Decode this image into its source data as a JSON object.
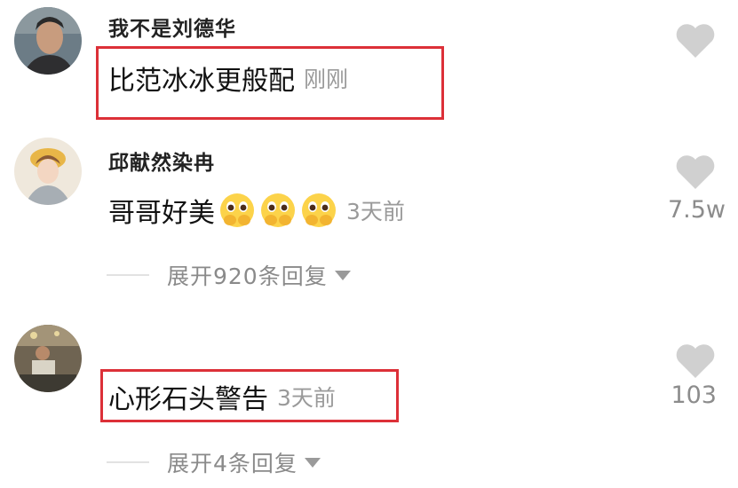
{
  "comments": [
    {
      "username": "我不是刘德华",
      "text": "比范冰冰更般配",
      "time": "刚刚",
      "like_count": ""
    },
    {
      "username": "邱献然染冉",
      "text": "哥哥好美",
      "emoji_count": 3,
      "time": "3天前",
      "like_count": "7.5w",
      "replies_label": "展开920条回复"
    },
    {
      "username": "",
      "text": "心形石头警告",
      "time": "3天前",
      "like_count": "103",
      "replies_label": "展开4条回复"
    }
  ],
  "colors": {
    "highlight_box": "#dc3038",
    "like_icon": "#d0d0d0",
    "muted_text": "#8a8a8a"
  },
  "icons": {
    "like": "heart-icon",
    "expand": "caret-down-icon",
    "emoji": "face-holding-back-tears-emoji"
  }
}
